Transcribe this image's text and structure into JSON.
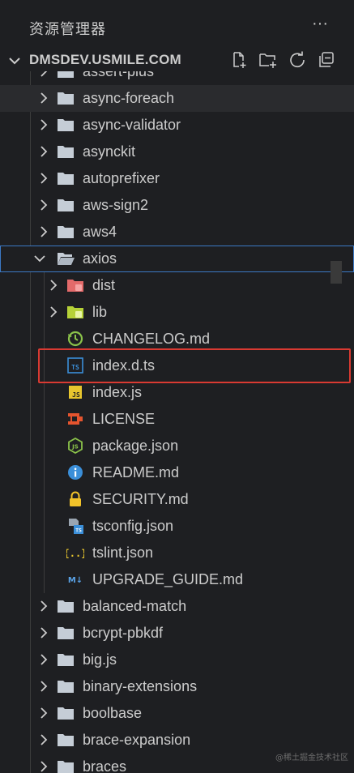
{
  "panel": {
    "title": "资源管理器",
    "more_label": "···"
  },
  "workspace": {
    "name": "DMSDEV.USMILE.COM",
    "actions": [
      {
        "icon": "new-file-icon"
      },
      {
        "icon": "new-folder-icon"
      },
      {
        "icon": "refresh-icon"
      },
      {
        "icon": "collapse-all-icon"
      }
    ]
  },
  "tree": {
    "rows": [
      {
        "label": "assert-plus",
        "kind": "folder",
        "expanded": false
      },
      {
        "label": "async-foreach",
        "kind": "folder",
        "expanded": false
      },
      {
        "label": "async-validator",
        "kind": "folder",
        "expanded": false
      },
      {
        "label": "asynckit",
        "kind": "folder",
        "expanded": false
      },
      {
        "label": "autoprefixer",
        "kind": "folder",
        "expanded": false
      },
      {
        "label": "aws-sign2",
        "kind": "folder",
        "expanded": false
      },
      {
        "label": "aws4",
        "kind": "folder",
        "expanded": false
      },
      {
        "label": "axios",
        "kind": "folder",
        "expanded": true
      },
      {
        "label": "dist",
        "kind": "folder-dist",
        "expanded": false
      },
      {
        "label": "lib",
        "kind": "folder-lib",
        "expanded": false
      },
      {
        "label": "CHANGELOG.md",
        "kind": "changelog"
      },
      {
        "label": "index.d.ts",
        "kind": "typescript-def"
      },
      {
        "label": "index.js",
        "kind": "javascript"
      },
      {
        "label": "LICENSE",
        "kind": "license"
      },
      {
        "label": "package.json",
        "kind": "node-json"
      },
      {
        "label": "README.md",
        "kind": "readme"
      },
      {
        "label": "SECURITY.md",
        "kind": "security"
      },
      {
        "label": "tsconfig.json",
        "kind": "tsconfig"
      },
      {
        "label": "tslint.json",
        "kind": "json"
      },
      {
        "label": "UPGRADE_GUIDE.md",
        "kind": "markdown"
      },
      {
        "label": "balanced-match",
        "kind": "folder",
        "expanded": false
      },
      {
        "label": "bcrypt-pbkdf",
        "kind": "folder",
        "expanded": false
      },
      {
        "label": "big.js",
        "kind": "folder",
        "expanded": false
      },
      {
        "label": "binary-extensions",
        "kind": "folder",
        "expanded": false
      },
      {
        "label": "boolbase",
        "kind": "folder",
        "expanded": false
      },
      {
        "label": "brace-expansion",
        "kind": "folder",
        "expanded": false
      },
      {
        "label": "braces",
        "kind": "folder",
        "expanded": false
      }
    ],
    "icon_text": {
      "ts": "TS",
      "js": "JS",
      "json_braces": "{..}",
      "md": "M↓"
    }
  },
  "colors": {
    "background": "#1e1f22",
    "selection_border": "#3b79c5",
    "highlight_box": "#d93a32",
    "folder": "#c5cdd6",
    "typescript": "#3b8fd9",
    "javascript": "#e8c62e"
  },
  "watermark": "@稀土掘金技术社区"
}
